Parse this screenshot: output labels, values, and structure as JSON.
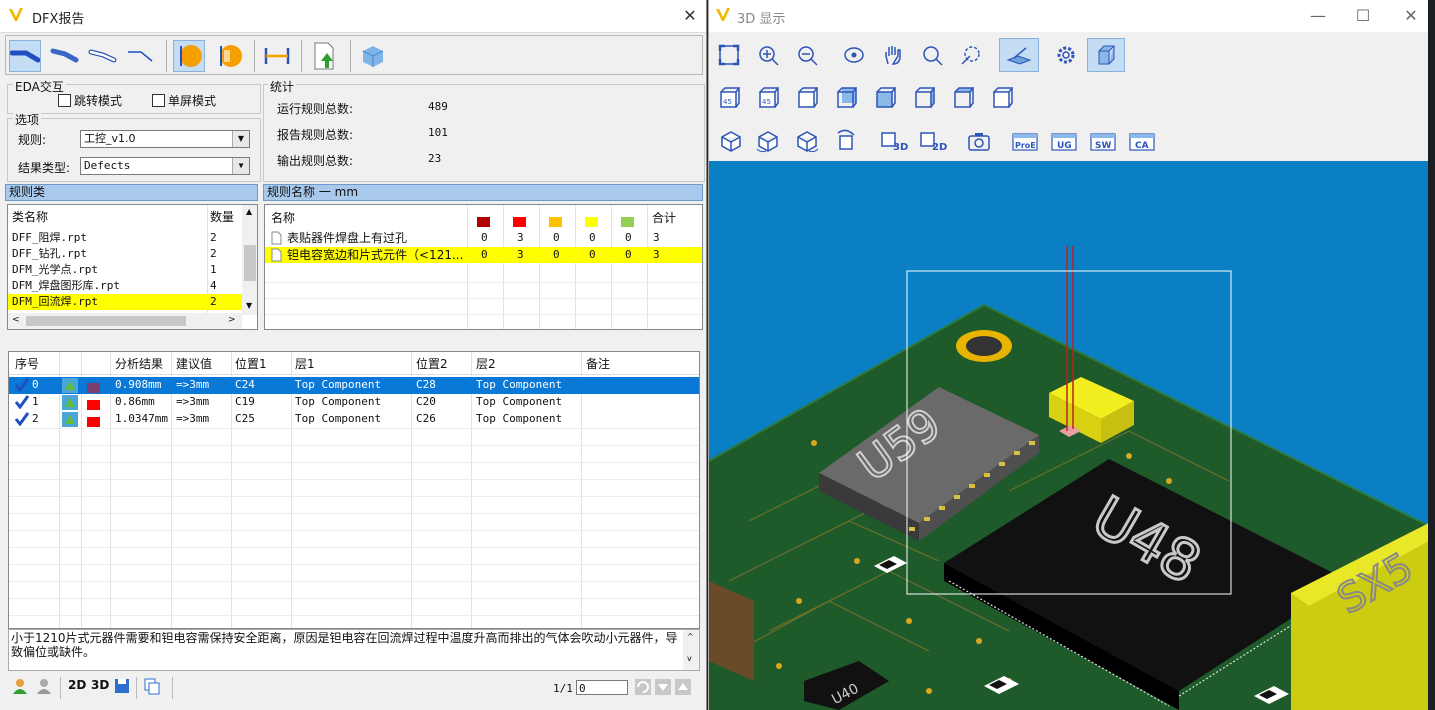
{
  "dfx_window": {
    "title": "DFX报告",
    "close_glyph": "✕"
  },
  "eda": {
    "group_label": "EDA交互",
    "jump_mode": "跳转模式",
    "single_screen": "单屏模式"
  },
  "options": {
    "group_label": "选项",
    "rule_label": "规则:",
    "rule_value": "工控_v1.0",
    "result_type_label": "结果类型:",
    "result_type_value": "Defects"
  },
  "stats": {
    "group_label": "统计",
    "items": [
      {
        "label": "运行规则总数:",
        "value": "489"
      },
      {
        "label": "报告规则总数:",
        "value": "101"
      },
      {
        "label": "输出规则总数:",
        "value": "23"
      }
    ]
  },
  "rule_class_panel": {
    "header": "规则类",
    "col_name": "类名称",
    "col_count": "数量",
    "rows": [
      {
        "name": "DFF_阻焊.rpt",
        "count": "2"
      },
      {
        "name": "DFF_钻孔.rpt",
        "count": "2"
      },
      {
        "name": "DFM_光学点.rpt",
        "count": "1"
      },
      {
        "name": "DFM_焊盘图形库.rpt",
        "count": "4"
      },
      {
        "name": "DFM_回流焊.rpt",
        "count": "2"
      }
    ],
    "selected_index": 4
  },
  "rule_name_panel": {
    "header": "规则名称 一 mm",
    "col_name": "名称",
    "severity_colors": [
      "#b00000",
      "#ff0000",
      "#ffc000",
      "#ffff00",
      "#92d050"
    ],
    "col_total": "合计",
    "rows": [
      {
        "name": "表贴器件焊盘上有过孔",
        "counts": [
          "0",
          "3",
          "0",
          "0",
          "0"
        ],
        "total": "3"
      },
      {
        "name": "钽电容宽边和片式元件（<121...",
        "counts": [
          "0",
          "3",
          "0",
          "0",
          "0"
        ],
        "total": "3"
      }
    ],
    "selected_index": 1
  },
  "results": {
    "headers": [
      "序号",
      "分析结果",
      "建议值",
      "位置1",
      "层1",
      "位置2",
      "层2",
      "备注"
    ],
    "rows": [
      {
        "idx": "0",
        "swatch": "#7b3f6e",
        "result": "0.908mm",
        "suggest": "=>3mm",
        "pos1": "C24",
        "layer1": "Top Component",
        "pos2": "C28",
        "layer2": "Top Component",
        "note": ""
      },
      {
        "idx": "1",
        "swatch": "#ff0000",
        "result": "0.86mm",
        "suggest": "=>3mm",
        "pos1": "C19",
        "layer1": "Top Component",
        "pos2": "C20",
        "layer2": "Top Component",
        "note": ""
      },
      {
        "idx": "2",
        "swatch": "#ff0000",
        "result": "1.0347mm",
        "suggest": "=>3mm",
        "pos1": "C25",
        "layer1": "Top Component",
        "pos2": "C26",
        "layer2": "Top Component",
        "note": ""
      }
    ],
    "selected_index": 0
  },
  "description": "小于1210片式元器件需要和钽电容需保持安全距离，原因是钽电容在回流焊过程中温度升高而排出的气体会吹动小元器件，导致偏位或缺件。",
  "statusbar": {
    "btn_2d": "2D",
    "btn_3d": "3D",
    "page": "1/1",
    "page_input": "0"
  },
  "v3d_window": {
    "title": "3D 显示",
    "minimize": "—",
    "maximize": "☐",
    "close": "✕",
    "row2_labels": [
      "45",
      "45"
    ],
    "row3_labels": [
      "3D",
      "2D",
      "ProE",
      "UG",
      "SW",
      "CA"
    ]
  },
  "board": {
    "chip1_label": "U59",
    "chip2_label": "U48",
    "chip3_label": "U40",
    "side_label": "SX5"
  }
}
